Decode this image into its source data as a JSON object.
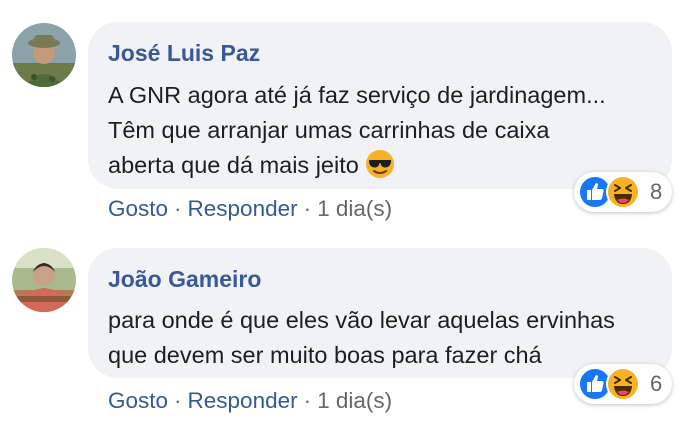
{
  "comments": [
    {
      "author": "José Luis Paz",
      "lines": [
        "A GNR agora até já faz serviço de jardinagem...",
        "Têm que arranjar umas carrinhas de caixa",
        "aberta que dá mais jeito"
      ],
      "inline_emoji": "sunglasses-emoji",
      "reactions": {
        "icons": [
          "like-icon",
          "haha-icon"
        ],
        "count": "8"
      },
      "actions": {
        "like": "Gosto",
        "separator": "·",
        "reply": "Responder",
        "time": "1 dia(s)"
      }
    },
    {
      "author": "João Gameiro",
      "lines": [
        "para onde é que eles vão levar aquelas ervinhas",
        "que devem ser muito boas para fazer chá"
      ],
      "reactions": {
        "icons": [
          "like-icon",
          "haha-icon"
        ],
        "count": "6"
      },
      "actions": {
        "like": "Gosto",
        "separator": "·",
        "reply": "Responder",
        "time": "1 dia(s)"
      }
    }
  ],
  "colors": {
    "bubble": "#f0f2f5",
    "author": "#385898",
    "text": "#1c1e21",
    "meta": "#65676b",
    "like_blue": "#1877f2",
    "haha_yellow": "#f7b125"
  }
}
